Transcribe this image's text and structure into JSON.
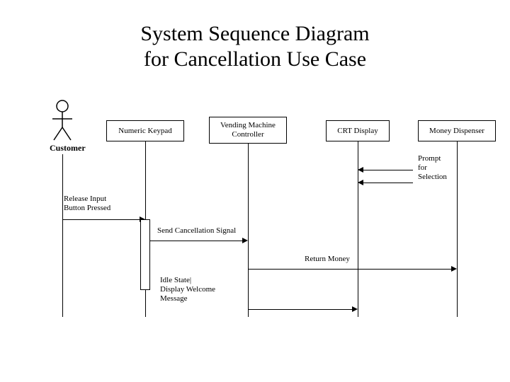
{
  "title": "System Sequence Diagram\nfor Cancellation Use Case",
  "actor": {
    "label": "Customer"
  },
  "participants": {
    "keypad": "Numeric Keypad",
    "controller": "Vending Machine\nController",
    "crt": "CRT Display",
    "dispenser": "Money Dispenser"
  },
  "notes": {
    "prompt": "Prompt\nfor\nSelection",
    "release": "Release Input\nButton Pressed",
    "idle": "Idle State|\nDisplay Welcome\nMessage"
  },
  "messages": {
    "sendCancel": "Send Cancellation Signal",
    "returnMoney": "Return Money"
  }
}
